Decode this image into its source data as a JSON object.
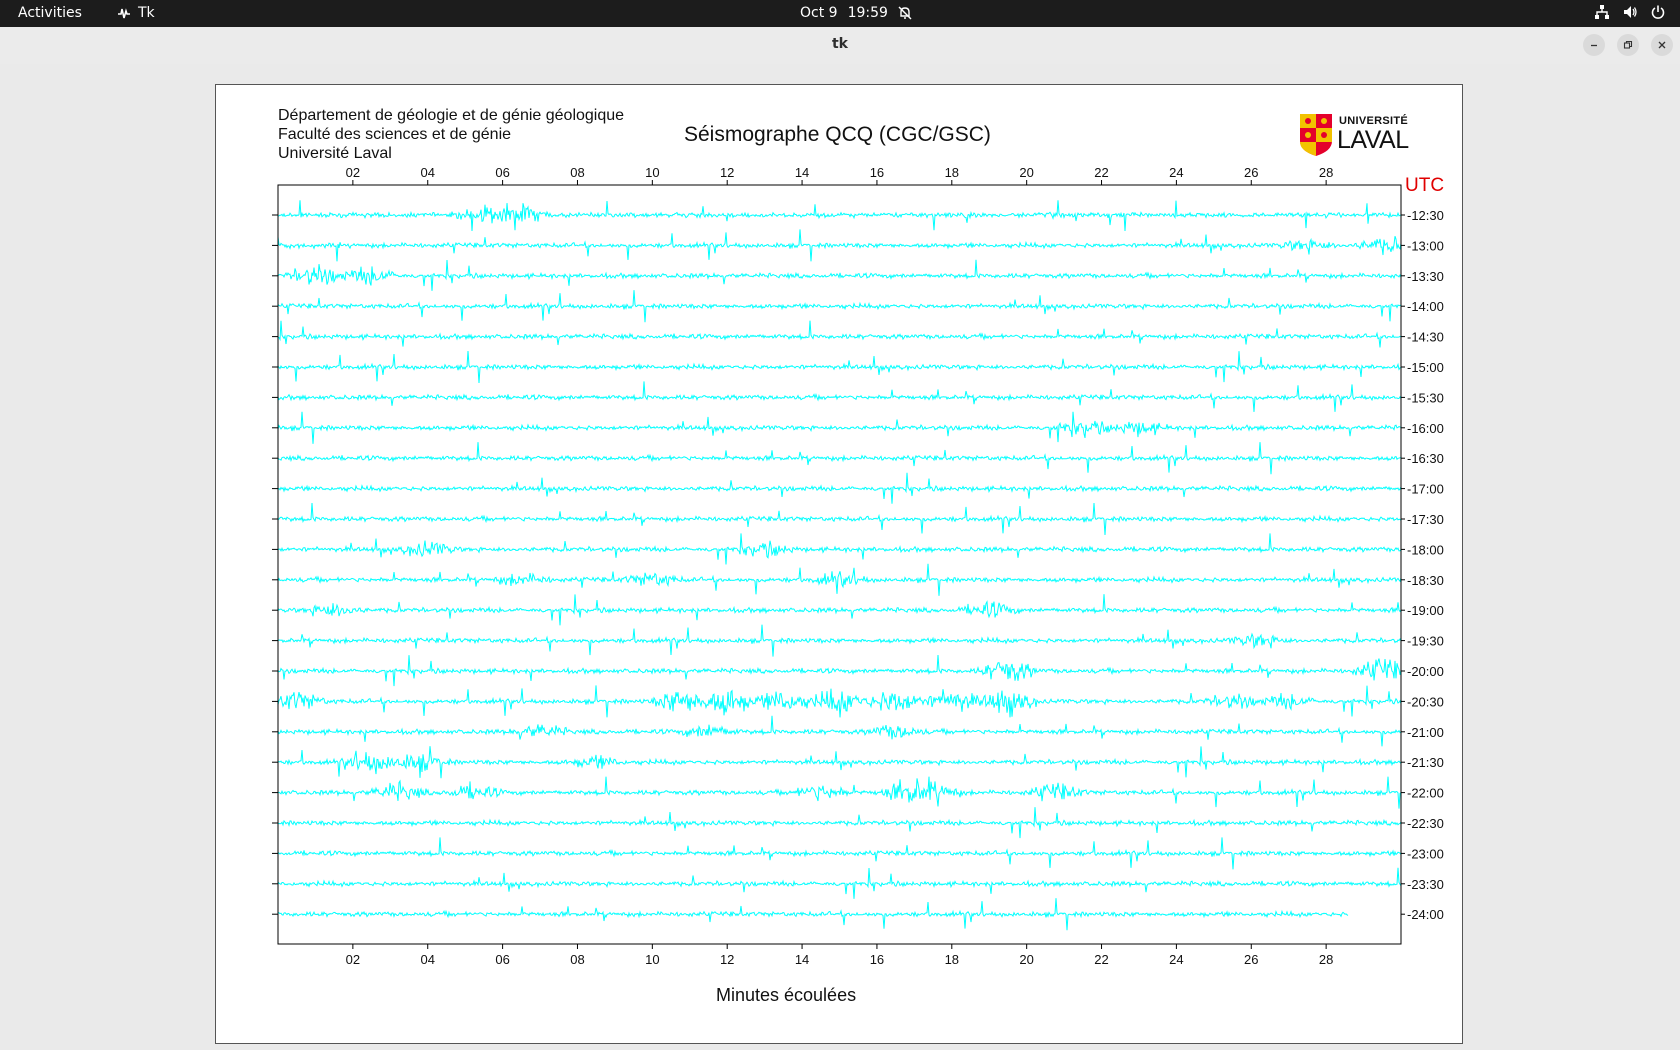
{
  "topbar": {
    "activities": "Activities",
    "app_name": "Tk",
    "date": "Oct 9",
    "time": "19:59",
    "icons": [
      "tk-app-icon",
      "notifications-muted-icon",
      "network-icon",
      "volume-icon",
      "power-icon"
    ]
  },
  "window": {
    "title": "tk",
    "controls": [
      "minimize-icon",
      "restore-icon",
      "close-icon"
    ]
  },
  "seismogram": {
    "header_lines": [
      "Département de géologie et de génie géologique",
      "Faculté des sciences et de génie",
      "Université Laval"
    ],
    "title": "Séismographe QCQ (CGC/GSC)",
    "logo_small_text": "UNIVERSITÉ",
    "logo_big_text": "LAVAL",
    "utc_label": "UTC",
    "x_title": "Minutes écoulées",
    "trace_color": "#00ffff",
    "utc_color": "#e00000"
  },
  "chart_data": {
    "type": "line",
    "title": "Séismographe QCQ (CGC/GSC)",
    "xlabel": "Minutes écoulées",
    "ylabel": "UTC",
    "xlim": [
      0,
      30
    ],
    "x_ticks": [
      "02",
      "04",
      "06",
      "08",
      "10",
      "12",
      "14",
      "16",
      "18",
      "20",
      "22",
      "24",
      "26",
      "28"
    ],
    "row_labels": [
      "12:30",
      "13:00",
      "13:30",
      "14:00",
      "14:30",
      "15:00",
      "15:30",
      "16:00",
      "16:30",
      "17:00",
      "17:30",
      "18:00",
      "18:30",
      "19:00",
      "19:30",
      "20:00",
      "20:30",
      "21:00",
      "21:30",
      "22:00",
      "22:30",
      "23:00",
      "23:30",
      "24:00"
    ],
    "last_row_end_minute": 28.6,
    "grid": false,
    "traces": "seismic amplitude traces, one per 30-minute row"
  }
}
